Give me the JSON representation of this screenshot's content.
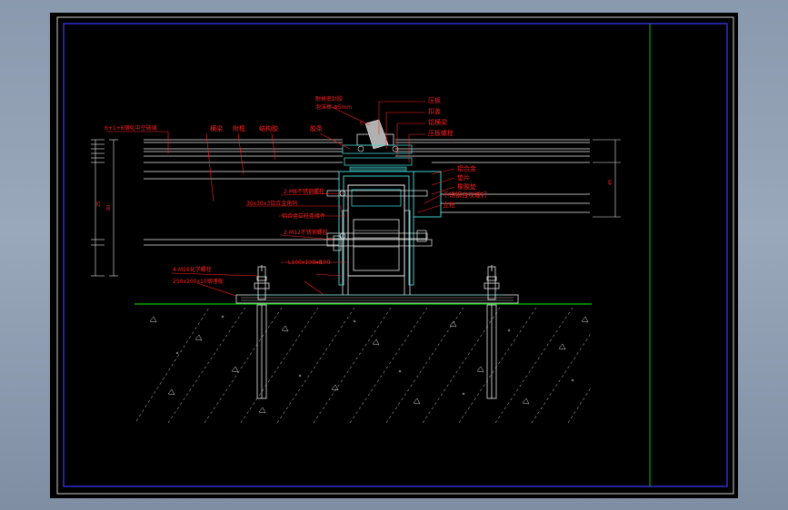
{
  "sheet": {
    "colors": {
      "background": "#000000",
      "frame": "#3a3aff",
      "title_divider": "#00c000",
      "annotation": "#ff2020",
      "profile": "#40d0d0",
      "white_detail": "#e8e8e8",
      "ground_line": "#00ff00",
      "concrete_hatch": "#d8d8d8"
    }
  },
  "labels_top": {
    "l1": "6+1+6钢化中空玻璃",
    "l2": "横梁",
    "l3": "附框",
    "l4": "结构胶",
    "l5": "胶条",
    "l6": "耐候密封胶",
    "l7": "泡沫棒 Φ5mm"
  },
  "labels_right": {
    "r1": "压板",
    "r2": "扣盖",
    "r3": "铝横梁",
    "r4": "压板螺栓",
    "r5": "铝合金",
    "r6": "垫片",
    "r7": "橡胶垫",
    "r8": "不锈钢自攻螺钉",
    "r9": "立柱"
  },
  "labels_left": {
    "a1": "2-M8不锈钢螺栓",
    "a2": "30x30x3铝合金角码",
    "a3": "铝合金立柱连接件",
    "a4": "2-M12不锈钢螺栓",
    "a5": "4-M16化学螺栓",
    "a6": "250x200x10钢埋板",
    "a7": "L100x100x8",
    "a8": "l=100",
    "a9": "5"
  },
  "dims": {
    "left_total": "80",
    "left_part": "25",
    "right_total": "45"
  }
}
